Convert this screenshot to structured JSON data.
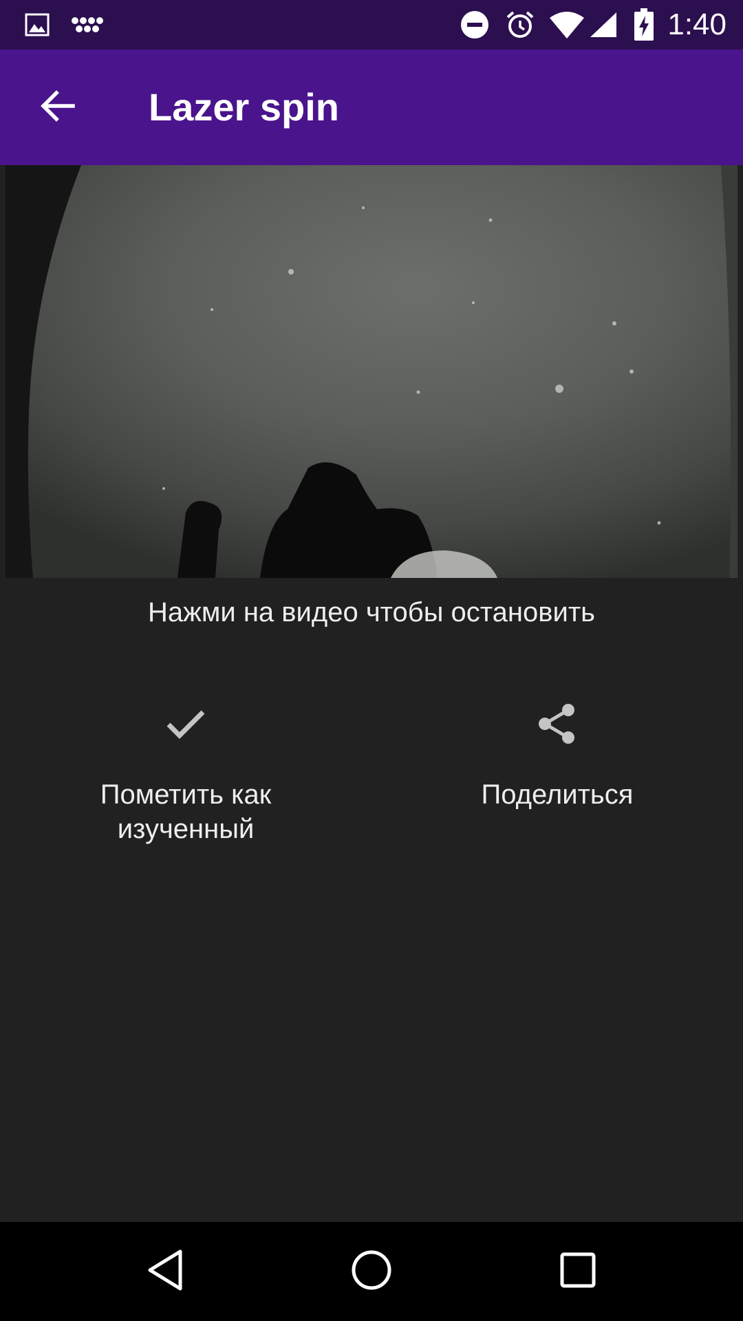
{
  "status_bar": {
    "time": "1:40",
    "left_icons": [
      "image-icon",
      "app-notification-icon"
    ],
    "right_icons": [
      "do-not-disturb-icon",
      "alarm-icon",
      "wifi-icon",
      "cell-signal-icon",
      "battery-charging-icon"
    ]
  },
  "app_bar": {
    "title": "Lazer spin",
    "back_icon": "arrow-back-icon",
    "background_color": "#4a148c"
  },
  "video": {
    "hint": "Нажми на видео чтобы остановить"
  },
  "actions": [
    {
      "icon": "check-icon",
      "label": "Пометить как изученный"
    },
    {
      "icon": "share-icon",
      "label": "Поделиться"
    }
  ],
  "nav_bar": {
    "icons": [
      "nav-back-icon",
      "nav-home-icon",
      "nav-recents-icon"
    ]
  }
}
